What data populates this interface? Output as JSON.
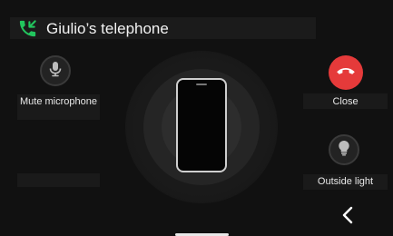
{
  "header": {
    "title": "Giulio’s telephone",
    "icon": "incoming-call-icon",
    "icon_color": "#22c55e"
  },
  "controls": {
    "mute": {
      "label": "Mute microphone",
      "icon": "microphone-icon"
    },
    "close": {
      "label": "Close",
      "icon": "hang-up-icon",
      "color": "#e53a3a"
    },
    "outside_light": {
      "label": "Outside light",
      "icon": "light-bulb-icon"
    }
  },
  "device": {
    "icon": "smartphone-icon"
  },
  "navigation": {
    "back_icon": "chevron-left-icon"
  }
}
